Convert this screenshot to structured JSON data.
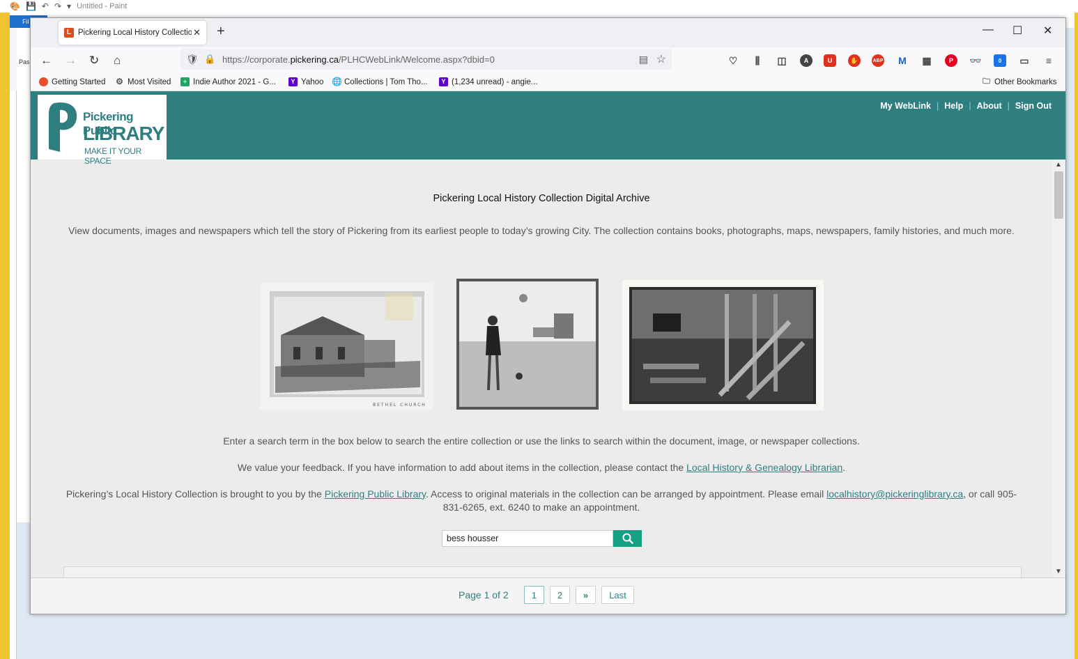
{
  "paint": {
    "title": "Untitled - Paint",
    "file_tab": "Fil",
    "paste_label": "Pas"
  },
  "browser": {
    "tab_title": "Pickering Local History Collectio",
    "tab_favicon": "L",
    "url_prefix": "https://corporate.",
    "url_domain": "pickering.ca",
    "url_path": "/PLHCWebLink/Welcome.aspx?dbid=0",
    "bookmarks": [
      {
        "label": "Getting Started",
        "icon": "firefox-icon",
        "color": "#e8502a"
      },
      {
        "label": "Most Visited",
        "icon": "gear-icon",
        "color": "#555555"
      },
      {
        "label": "Indie Author 2021 - G...",
        "icon": "sheets-icon",
        "color": "#1fa463"
      },
      {
        "label": "Yahoo",
        "icon": "yahoo-icon",
        "color": "#6001d2"
      },
      {
        "label": "Collections | Tom Tho...",
        "icon": "globe-icon",
        "color": "#555555"
      },
      {
        "label": "(1,234 unread) - angie...",
        "icon": "yahoo-mail-icon",
        "color": "#6001d2"
      }
    ],
    "other_bookmarks": "Other Bookmarks",
    "ext_badge": "0"
  },
  "site": {
    "logo": {
      "line1": "Pickering Public",
      "line2": "LIBRARY",
      "line3": "MAKE IT YOUR SPACE"
    },
    "nav": [
      "My WebLink",
      "Help",
      "About",
      "Sign Out"
    ],
    "heading": "Pickering Local History Collection Digital Archive",
    "intro": "View documents, images and newspapers which tell the story of Pickering from its earliest people to today’s growing City. The collection contains books, photographs, maps, newspapers, family histories, and much more.",
    "photo1_caption": "BETHEL CHURCH",
    "para_search": "Enter a search term in the box below to search the entire collection or use the links to search within the document, image, or newspaper collections.",
    "para_feedback_pre": "We value your feedback. If you have information to add about items in the collection, please contact the ",
    "para_feedback_link": "Local History & Genealogy Librarian",
    "para_feedback_post": ".",
    "para_brought_pre": "Pickering’s Local History Collection is brought to you by the ",
    "para_brought_link": "Pickering Public Library",
    "para_brought_mid": ". Access to original materials in the collection can be arranged by appointment. Please email ",
    "para_brought_email": "localhistory@pickeringlibrary.ca",
    "para_brought_post": ", or call 905-831-6265, ext. 6240 to make an appointment.",
    "search_value": "bess housser",
    "accent": "#2f7f80",
    "search_button_color": "#15a085"
  },
  "pager": {
    "info": "Page 1 of 2",
    "pages": [
      "1",
      "2"
    ],
    "next": "»",
    "last": "Last"
  }
}
